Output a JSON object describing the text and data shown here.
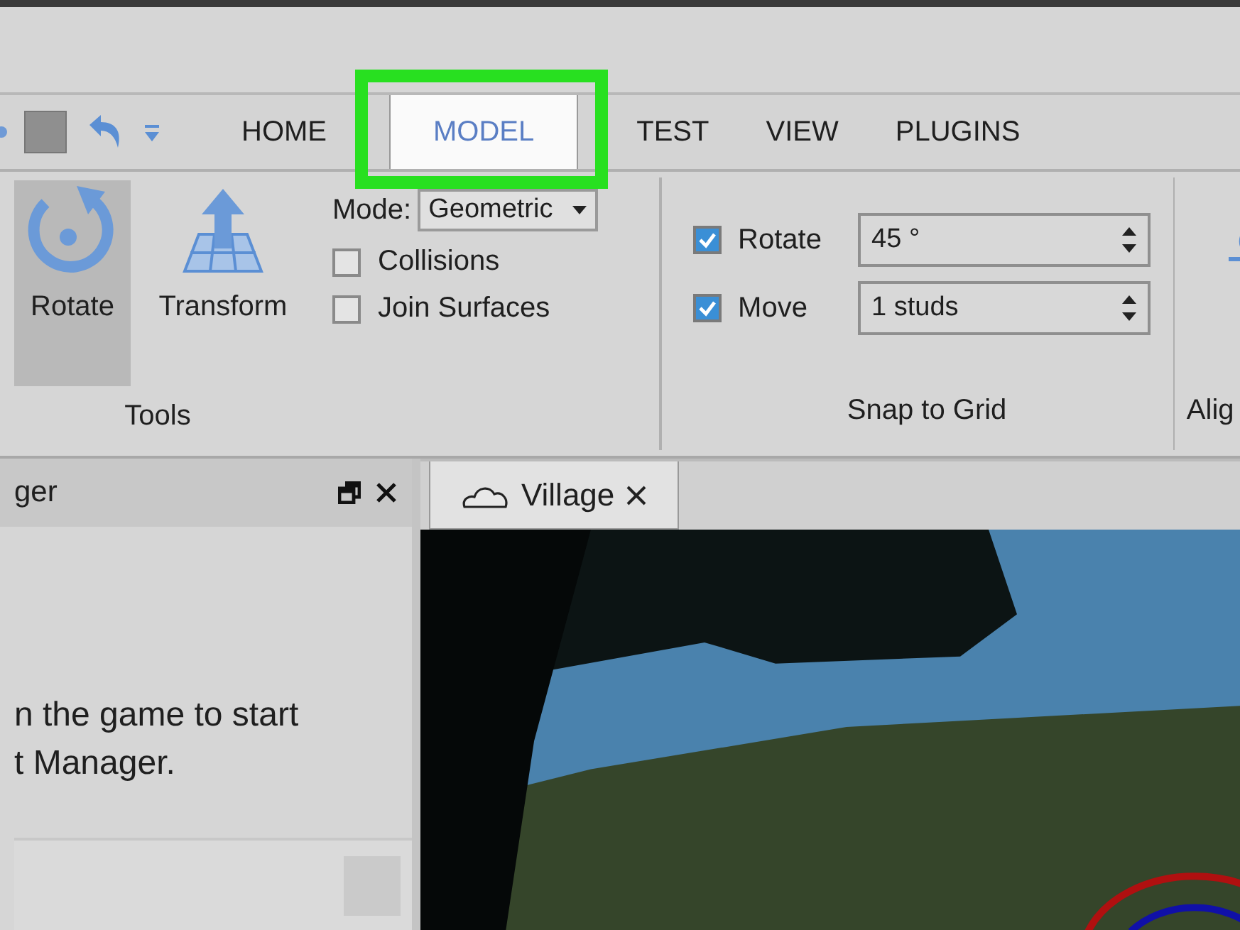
{
  "tabs": [
    {
      "label": "HOME",
      "selected": false
    },
    {
      "label": "MODEL",
      "selected": true
    },
    {
      "label": "TEST",
      "selected": false
    },
    {
      "label": "VIEW",
      "selected": false
    },
    {
      "label": "PLUGINS",
      "selected": false
    }
  ],
  "tools": {
    "label": "Tools",
    "buttons": [
      {
        "label": "Rotate",
        "selected": true,
        "kind": "rotate"
      },
      {
        "label": "Transform",
        "selected": false,
        "kind": "transform"
      }
    ]
  },
  "mode": {
    "label": "Mode:",
    "value": "Geometric"
  },
  "options": [
    {
      "label": "Collisions",
      "checked": false
    },
    {
      "label": "Join Surfaces",
      "checked": false
    }
  ],
  "snap": {
    "label": "Snap to Grid",
    "rows": [
      {
        "label": "Rotate",
        "checked": true,
        "value": "45 °"
      },
      {
        "label": "Move",
        "checked": true,
        "value": "1 studs"
      }
    ]
  },
  "align": {
    "label": "Alig"
  },
  "panel": {
    "title": "ger",
    "message_lines": [
      "n the game to start",
      "t Manager."
    ]
  },
  "viewport_tabs": [
    {
      "label": "Village",
      "selected": true
    }
  ]
}
